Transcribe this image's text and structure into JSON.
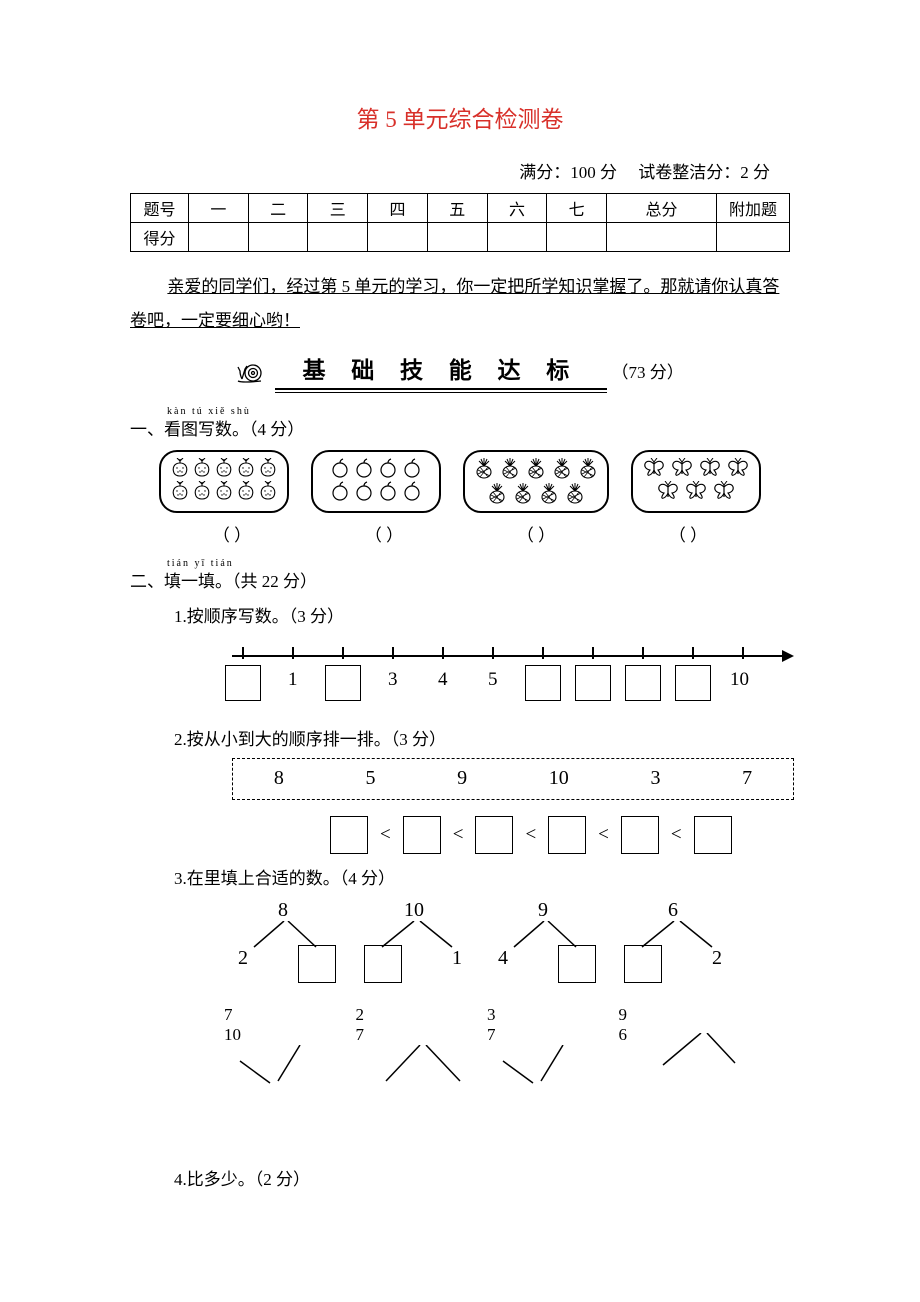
{
  "title": "第 5 单元综合检测卷",
  "meta": {
    "full": "满分：100 分",
    "tidy": "试卷整洁分：2 分"
  },
  "score_table": {
    "row1": [
      "题号",
      "一",
      "二",
      "三",
      "四",
      "五",
      "六",
      "七",
      "总分",
      "附加题"
    ],
    "row2_label": "得分"
  },
  "intro": "亲爱的同学们，经过第 5 单元的学习，你一定把所学知识掌握了。那就请你认真答卷吧，一定要细心哟！",
  "section_banner": "基 础 技 能 达 标",
  "section_points": "（73 分）",
  "q1": {
    "pinyin": "kàn tú xiě shù",
    "label": "一、看图写数。（4 分）",
    "items": [
      {
        "icon": "strawberry",
        "rows": [
          5,
          5
        ]
      },
      {
        "icon": "apple",
        "rows": [
          4,
          4
        ]
      },
      {
        "icon": "pineapple",
        "rows": [
          5,
          4
        ]
      },
      {
        "icon": "butterfly",
        "rows": [
          4,
          3
        ]
      }
    ],
    "blank": [
      "（        ）",
      "（        ）",
      "（        ）",
      "（        ）"
    ]
  },
  "q2": {
    "pinyin": "tián yī tián",
    "label": "二、填一填。（共 22 分）",
    "s1": {
      "label": "1.按顺序写数。（3 分）",
      "labels": {
        "1": "1",
        "3": "3",
        "4": "4",
        "5": "5",
        "10": "10"
      }
    },
    "s2": {
      "label": "2.按从小到大的顺序排一排。（3 分）",
      "nums": [
        "8",
        "5",
        "9",
        "10",
        "3",
        "7"
      ],
      "op": "<"
    },
    "s3": {
      "label": "3.在里填上合适的数。（4 分）",
      "top": [
        {
          "a": "8",
          "left": "2",
          "box": "right"
        },
        {
          "a": "10",
          "right": "1",
          "box": "left"
        },
        {
          "a": "9",
          "left": "4",
          "box": "right"
        },
        {
          "a": "6",
          "right": "2",
          "box": "left"
        }
      ],
      "bottom": [
        {
          "left": "7",
          "c1": "10"
        },
        {
          "c1": "2",
          "c2": "7"
        },
        {
          "left": "3",
          "c1": "7"
        },
        {
          "right": "9",
          "c0": "6"
        }
      ]
    },
    "s4": {
      "label": "4.比多少。（2 分）"
    }
  }
}
